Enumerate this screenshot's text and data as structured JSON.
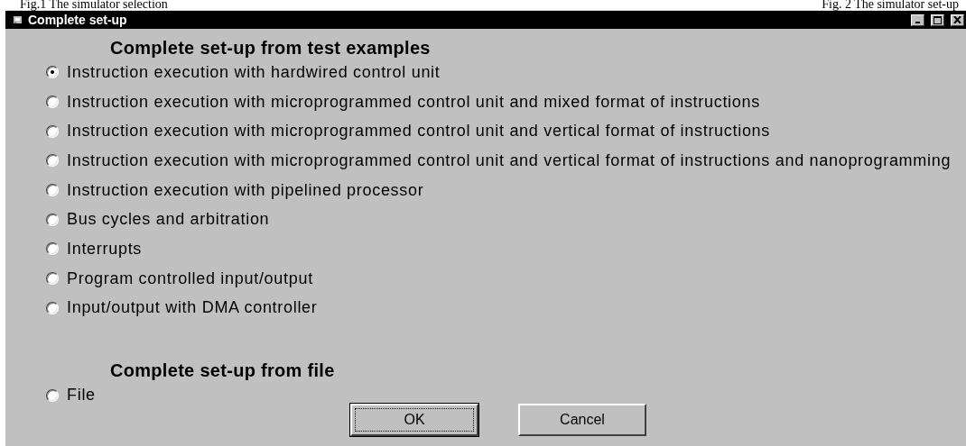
{
  "page_captions": [
    "Fig.1 The simulator selection",
    "Fig. 2 The simulator set-up"
  ],
  "window": {
    "title": "Complete set-up"
  },
  "sections": [
    {
      "heading": "Complete set-up from test examples",
      "options": [
        {
          "label": "Instruction execution with hardwired control unit",
          "selected": true
        },
        {
          "label": "Instruction execution with microprogrammed control unit and mixed format of instructions",
          "selected": false
        },
        {
          "label": "Instruction execution with microprogrammed control unit and vertical format of instructions",
          "selected": false
        },
        {
          "label": "Instruction execution with microprogrammed control unit and vertical format of instructions and nanoprogramming",
          "selected": false
        },
        {
          "label": "Instruction execution with pipelined processor",
          "selected": false
        },
        {
          "label": "Bus cycles and arbitration",
          "selected": false
        },
        {
          "label": "Interrupts",
          "selected": false
        },
        {
          "label": "Program controlled input/output",
          "selected": false
        },
        {
          "label": "Input/output with DMA controller",
          "selected": false
        }
      ]
    },
    {
      "heading": "Complete set-up from file",
      "options": [
        {
          "label": "File",
          "selected": false
        }
      ]
    }
  ],
  "buttons": [
    {
      "label": "OK",
      "default": true
    },
    {
      "label": "Cancel",
      "default": false
    }
  ]
}
